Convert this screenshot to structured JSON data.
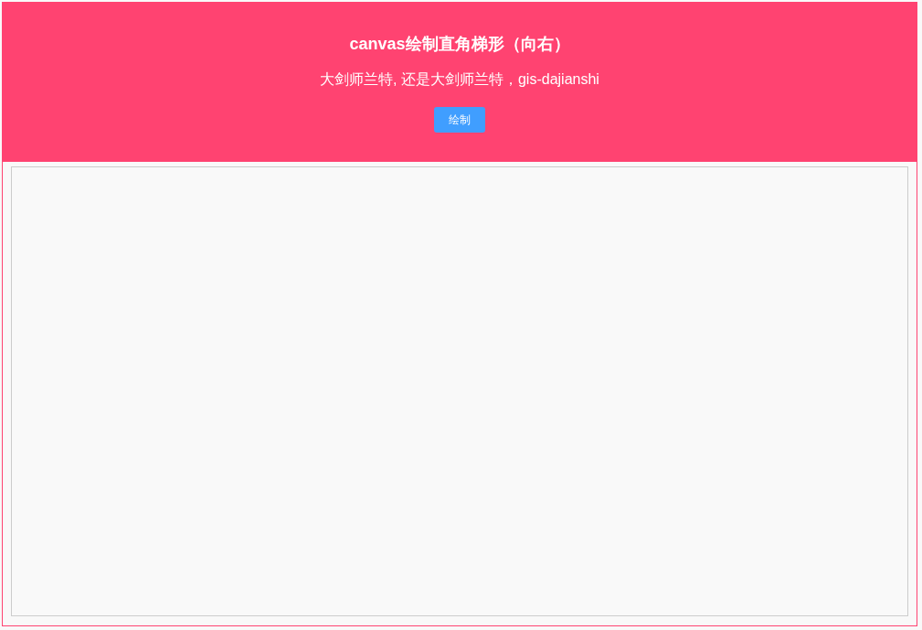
{
  "header": {
    "title": "canvas绘制直角梯形（向右）",
    "subtitle": "大剑师兰特, 还是大剑师兰特，gis-dajianshi",
    "button": "绘制"
  }
}
